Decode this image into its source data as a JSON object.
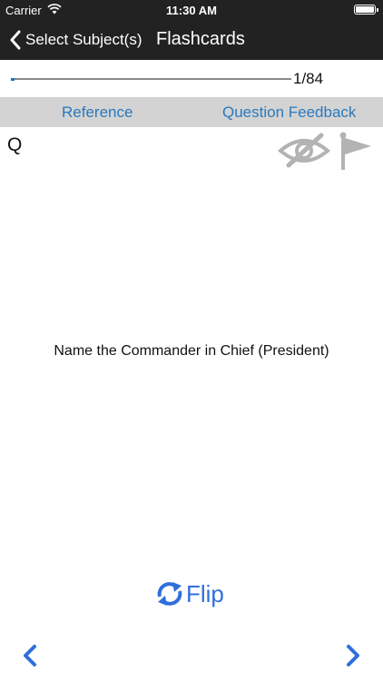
{
  "status": {
    "carrier": "Carrier",
    "time": "11:30 AM"
  },
  "nav": {
    "back_label": "Select Subject(s)",
    "title": "Flashcards"
  },
  "progress": {
    "current": 1,
    "total": 84,
    "label": "1/84",
    "fraction": 0.012
  },
  "links": {
    "reference": "Reference",
    "feedback": "Question Feedback"
  },
  "card": {
    "side_label": "Q",
    "text": "Name the Commander in Chief (President)"
  },
  "flip": {
    "label": "Flip"
  },
  "colors": {
    "bar_bg": "#222222",
    "link": "#2a79bd",
    "accent": "#2f6fdb",
    "linkbar_bg": "#d3d3d3",
    "icon_gray": "#b3b3b3"
  },
  "icons": {
    "back": "chevron-left-icon",
    "hide": "eye-slash-icon",
    "flag": "flag-icon",
    "flip": "refresh-icon",
    "prev": "chevron-left-icon",
    "next": "chevron-right-icon"
  }
}
